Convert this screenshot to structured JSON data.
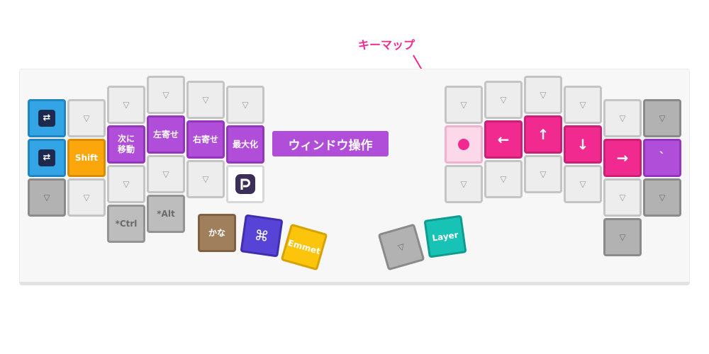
{
  "callout": {
    "text": "キーマップ",
    "color": "#f02a8e"
  },
  "section_label": {
    "text": "ウィンドウ操作",
    "color": "#b04ed9"
  },
  "keys": {
    "blank": "▽",
    "shift": "Shift",
    "move_next": "次に\n移動",
    "left_half": "左寄せ",
    "right_half": "右寄せ",
    "maximize": "最大化",
    "ctrl": "*Ctrl",
    "alt": "*Alt",
    "kana": "かな",
    "cmd": "⌘",
    "emmet": "Emmet",
    "layer": "Layer",
    "arrow_left": "←",
    "arrow_up": "↑",
    "arrow_down": "↓",
    "arrow_right": "→",
    "backtick": "`"
  },
  "colors": {
    "window_layer": "#b04ed9",
    "arrow_layer": "#f02a8e",
    "shift": "#fba70b",
    "app_switch": "#33a5e6",
    "kana": "#a07f5c",
    "cmd": "#5744d6",
    "emmet": "#fcc40a",
    "layer": "#18c2b5"
  }
}
